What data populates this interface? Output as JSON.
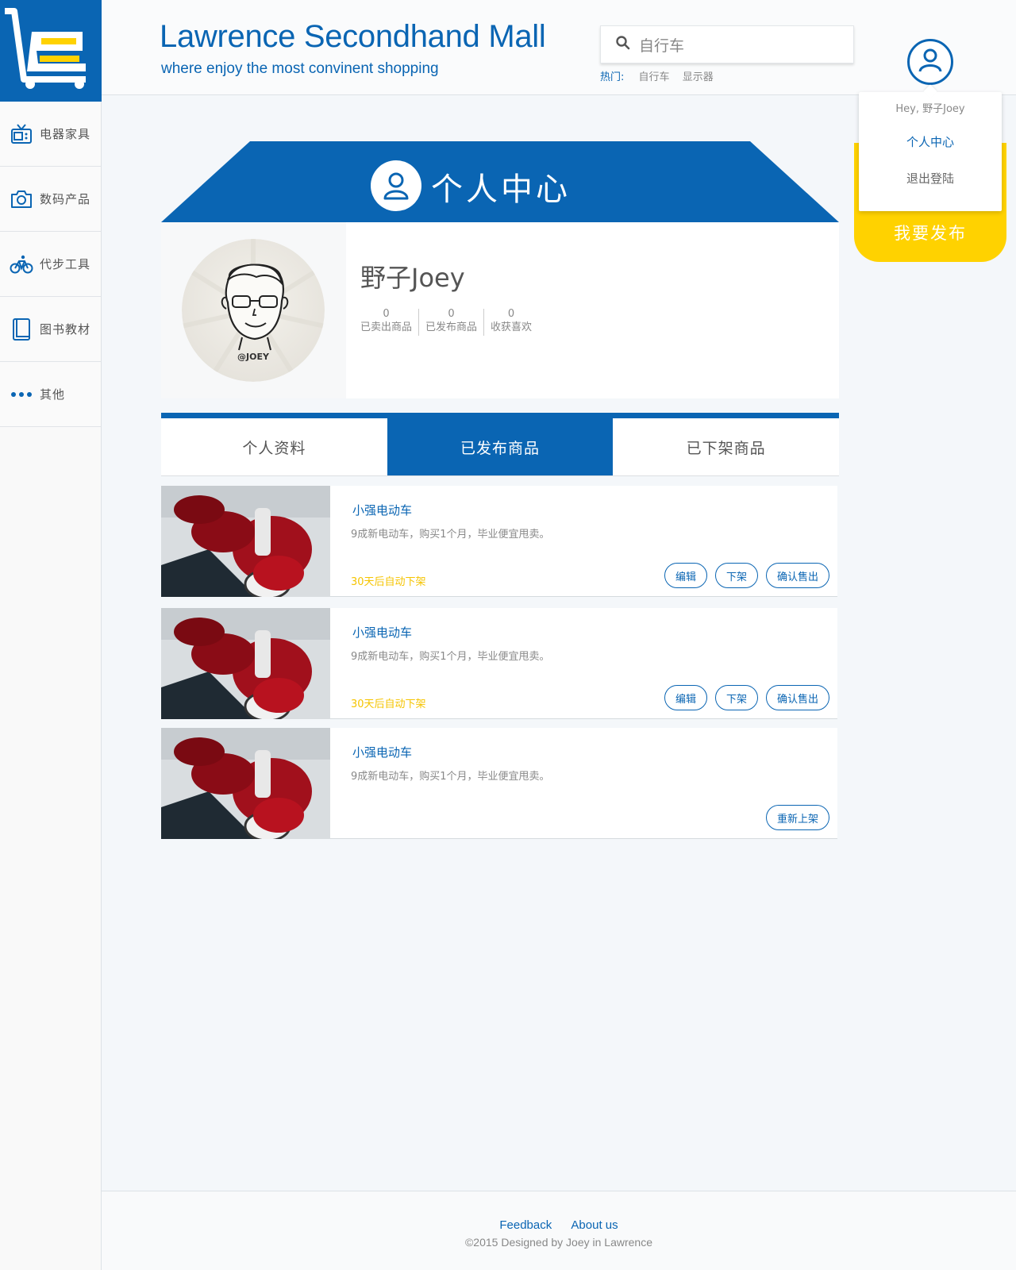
{
  "colors": {
    "primary": "#0a65b3",
    "accent": "#ffd200",
    "auto_text": "#f5c400"
  },
  "header": {
    "title": "Lawrence Secondhand Mall",
    "subtitle": "where enjoy the most convinent shopping",
    "search_value": "自行车",
    "hot_label": "热门:",
    "hot_tags": [
      "自行车",
      "显示器"
    ]
  },
  "sidebar": {
    "items": [
      {
        "label": "电器家具",
        "icon": "tv-icon"
      },
      {
        "label": "数码产品",
        "icon": "camera-icon"
      },
      {
        "label": "代步工具",
        "icon": "bicycle-icon"
      },
      {
        "label": "图书教材",
        "icon": "book-icon"
      },
      {
        "label": "其他",
        "icon": "more-icon"
      }
    ]
  },
  "user_menu": {
    "greeting": "Hey, 野子Joey",
    "center": "个人中心",
    "logout": "退出登陆"
  },
  "publish_label": "我要发布",
  "banner_title": "个人中心",
  "profile": {
    "avatar_text": "@JOEY",
    "name": "野子Joey",
    "stats": [
      {
        "value": "0",
        "label": "已卖出商品"
      },
      {
        "value": "0",
        "label": "已发布商品"
      },
      {
        "value": "0",
        "label": "收获喜欢"
      }
    ]
  },
  "tabs": [
    {
      "label": "个人资料"
    },
    {
      "label": "已发布商品"
    },
    {
      "label": "已下架商品"
    }
  ],
  "items": [
    {
      "name": "小强电动车",
      "desc": "9成新电动车，购买1个月，毕业便宜甩卖。",
      "auto_text": "30天后自动下架",
      "actions": [
        "编辑",
        "下架",
        "确认售出"
      ]
    },
    {
      "name": "小强电动车",
      "desc": "9成新电动车，购买1个月，毕业便宜甩卖。",
      "auto_text": "30天后自动下架",
      "actions": [
        "编辑",
        "下架",
        "确认售出"
      ]
    },
    {
      "name": "小强电动车",
      "desc": "9成新电动车，购买1个月，毕业便宜甩卖。",
      "auto_text": "",
      "actions": [
        "重新上架"
      ]
    }
  ],
  "footer": {
    "links": [
      "Feedback",
      "About us"
    ],
    "copyright": "©2015  Designed by Joey in Lawrence"
  }
}
